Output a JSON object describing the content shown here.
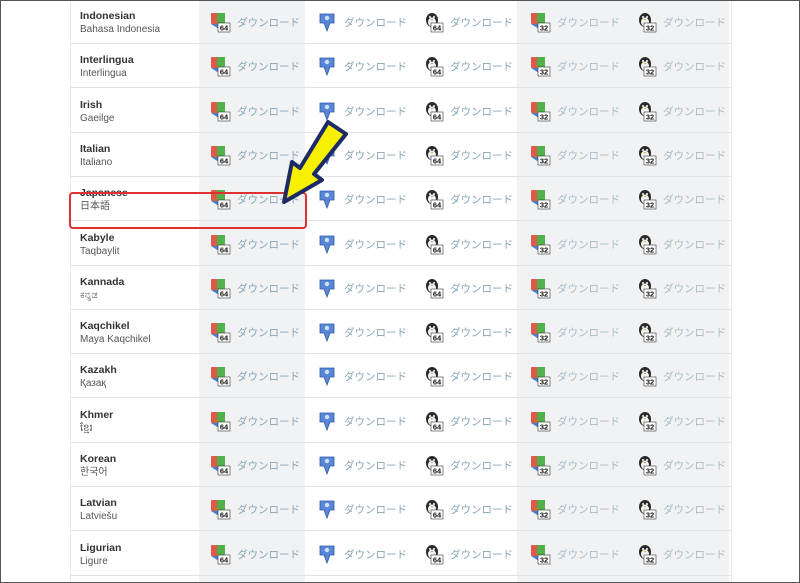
{
  "download_label": "ダウンロード",
  "colors": {
    "highlight": "#e03131",
    "arrow": "#f7f000",
    "link": "#8aa6b5"
  },
  "icons": [
    "windows-64-icon",
    "mac-icon",
    "linux-64-icon",
    "windows-32-icon",
    "linux-32-icon"
  ],
  "badges": {
    "b64": "64",
    "b32": "32"
  },
  "languages": [
    {
      "en": "Indonesian",
      "native": "Bahasa Indonesia"
    },
    {
      "en": "Interlingua",
      "native": "Interlingua"
    },
    {
      "en": "Irish",
      "native": "Gaeilge"
    },
    {
      "en": "Italian",
      "native": "Italiano"
    },
    {
      "en": "Japanese",
      "native": "日本語"
    },
    {
      "en": "Kabyle",
      "native": "Taqbaylit"
    },
    {
      "en": "Kannada",
      "native": "ಕನ್ನಡ"
    },
    {
      "en": "Kaqchikel",
      "native": "Maya Kaqchikel"
    },
    {
      "en": "Kazakh",
      "native": "Қазақ"
    },
    {
      "en": "Khmer",
      "native": "ខ្មែរ"
    },
    {
      "en": "Korean",
      "native": "한국어"
    },
    {
      "en": "Latvian",
      "native": "Latviešu"
    },
    {
      "en": "Ligurian",
      "native": "Ligure"
    }
  ]
}
